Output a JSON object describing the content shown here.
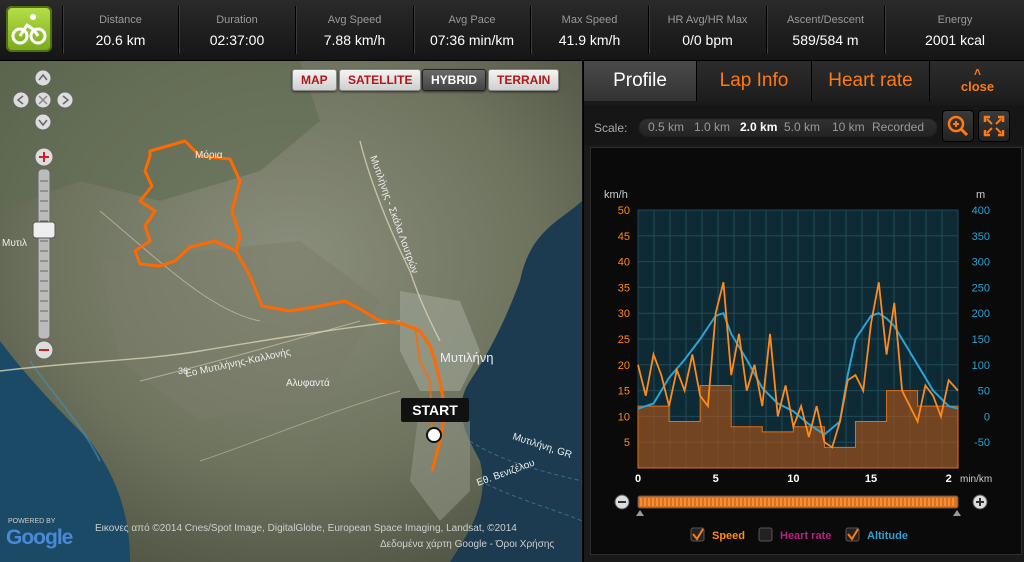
{
  "stats": [
    {
      "label": "Distance",
      "value": "20.6 km"
    },
    {
      "label": "Duration",
      "value": "02:37:00"
    },
    {
      "label": "Avg Speed",
      "value": "7.88 km/h"
    },
    {
      "label": "Avg Pace",
      "value": "07:36 min/km"
    },
    {
      "label": "Max Speed",
      "value": "41.9 km/h"
    },
    {
      "label": "HR Avg/HR Max",
      "value": "0/0 bpm"
    },
    {
      "label": "Ascent/Descent",
      "value": "589/584 m"
    },
    {
      "label": "Energy",
      "value": "2001 kcal"
    }
  ],
  "map": {
    "types": [
      "MAP",
      "SATELLITE",
      "HYBRID",
      "TERRAIN"
    ],
    "active_type": "HYBRID",
    "start_label": "START",
    "attribution_1": "Εικονες από ©2014 Cnes/Spot Image, DigitalGlobe, European Space Imaging, Landsat, ©2014",
    "attribution_2": "Δεδομένα χάρτη Google - Όροι Χρήσης",
    "powered_by": "POWERED BY",
    "google": "Google",
    "place_labels": [
      "Μόρια",
      "Μυτιλήνη",
      "Αλυφαντά",
      "Εο Μυτιλήνης-Καλλονής",
      "Μυτιλήνης - Σκάλα Λουτρών",
      "36",
      "Μυτιλ",
      "Μυτιλήνη, GR",
      "Εθ. Βενιζέλου"
    ]
  },
  "panel": {
    "tabs": [
      "Profile",
      "Lap Info",
      "Heart rate"
    ],
    "active_tab": "Profile",
    "close_label": "close",
    "scale_label": "Scale:",
    "scale_options": [
      "0.5 km",
      "1.0 km",
      "2.0 km",
      "5.0 km",
      "10 km",
      "Recorded"
    ],
    "scale_selected": "2.0 km",
    "colors": {
      "speed": "#ff8a1a",
      "altitude": "#2aa3d6",
      "heart": "#b5217e",
      "accent": "#ff7a12"
    }
  },
  "chart_data": {
    "type": "line",
    "y_left_label": "km/h",
    "y_right_label": "m",
    "x_unit": "min/km",
    "y_left_ticks": [
      5,
      10,
      15,
      20,
      25,
      30,
      35,
      40,
      45,
      50
    ],
    "y_right_ticks": [
      -50,
      0,
      50,
      100,
      150,
      200,
      250,
      300,
      350,
      400
    ],
    "x_ticks": [
      "0",
      "5",
      "10",
      "15",
      "2"
    ],
    "ylim_left": [
      0,
      50
    ],
    "ylim_right": [
      -100,
      400
    ],
    "xlim": [
      0,
      20.6
    ],
    "legend": [
      {
        "name": "Speed",
        "checked": true
      },
      {
        "name": "Heart rate",
        "checked": false
      },
      {
        "name": "Altitude",
        "checked": true
      }
    ],
    "series": [
      {
        "name": "Speed",
        "values": [
          [
            0,
            20
          ],
          [
            0.5,
            14
          ],
          [
            1,
            22
          ],
          [
            1.5,
            18
          ],
          [
            2,
            12
          ],
          [
            2.5,
            19
          ],
          [
            3,
            15
          ],
          [
            3.5,
            22
          ],
          [
            4,
            14
          ],
          [
            4.5,
            12
          ],
          [
            5,
            30
          ],
          [
            5.5,
            36
          ],
          [
            6,
            18
          ],
          [
            6.5,
            26
          ],
          [
            7,
            15
          ],
          [
            7.5,
            20
          ],
          [
            8,
            12
          ],
          [
            8.5,
            26
          ],
          [
            9,
            10
          ],
          [
            9.5,
            16
          ],
          [
            10,
            8
          ],
          [
            10.5,
            12
          ],
          [
            11,
            6
          ],
          [
            11.5,
            12
          ],
          [
            12,
            5
          ],
          [
            12.5,
            4
          ],
          [
            13,
            9
          ],
          [
            13.5,
            17
          ],
          [
            14,
            18
          ],
          [
            14.5,
            15
          ],
          [
            15,
            28
          ],
          [
            15.5,
            36
          ],
          [
            16,
            22
          ],
          [
            16.5,
            32
          ],
          [
            17,
            15
          ],
          [
            17.5,
            12
          ],
          [
            18,
            9
          ],
          [
            18.5,
            16
          ],
          [
            19,
            14
          ],
          [
            19.5,
            10
          ],
          [
            20,
            17
          ],
          [
            20.6,
            15
          ]
        ]
      },
      {
        "name": "Altitude",
        "values": [
          [
            0,
            15
          ],
          [
            1,
            25
          ],
          [
            2,
            75
          ],
          [
            3,
            110
          ],
          [
            4,
            150
          ],
          [
            5,
            195
          ],
          [
            5.5,
            200
          ],
          [
            6,
            160
          ],
          [
            7,
            110
          ],
          [
            8,
            55
          ],
          [
            9,
            25
          ],
          [
            10,
            10
          ],
          [
            11,
            -15
          ],
          [
            12,
            -35
          ],
          [
            13,
            -10
          ],
          [
            13.5,
            80
          ],
          [
            14,
            150
          ],
          [
            15,
            195
          ],
          [
            15.5,
            200
          ],
          [
            16,
            190
          ],
          [
            16.5,
            175
          ],
          [
            17,
            150
          ],
          [
            18,
            100
          ],
          [
            19,
            50
          ],
          [
            20,
            20
          ],
          [
            20.6,
            15
          ]
        ]
      },
      {
        "name": "Lap Avg Speed",
        "values": [
          [
            0,
            12
          ],
          [
            2,
            12
          ],
          [
            2,
            9
          ],
          [
            4,
            9
          ],
          [
            4,
            16
          ],
          [
            6,
            16
          ],
          [
            6,
            8
          ],
          [
            8,
            8
          ],
          [
            8,
            7
          ],
          [
            10,
            7
          ],
          [
            10,
            8
          ],
          [
            12,
            8
          ],
          [
            12,
            4
          ],
          [
            14,
            4
          ],
          [
            14,
            9
          ],
          [
            16,
            9
          ],
          [
            16,
            15
          ],
          [
            18,
            15
          ],
          [
            18,
            12
          ],
          [
            20.6,
            12
          ]
        ]
      }
    ]
  }
}
